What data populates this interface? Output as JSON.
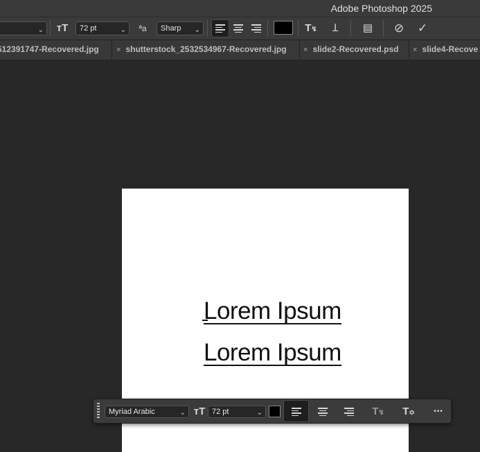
{
  "window": {
    "title": "Adobe Photoshop 2025"
  },
  "options_bar": {
    "font_size": "72 pt",
    "anti_alias": "Sharp",
    "icons": [
      "chevron-down-icon",
      "text-size-icon",
      "anti-alias-icon",
      "align-left-icon",
      "align-center-icon",
      "align-right-icon",
      "warp-text-icon",
      "3d-text-icon",
      "character-panel-icon",
      "cancel-icon",
      "commit-checkmark-icon"
    ],
    "text_color": "#000000"
  },
  "tabs": [
    {
      "label": "512391747-Recovered.jpg",
      "close": ""
    },
    {
      "label": "shutterstock_2532534967-Recovered.jpg",
      "close": "×"
    },
    {
      "label": "slide2-Recovered.psd",
      "close": "×"
    },
    {
      "label": "slide4-Recove",
      "close": "×"
    }
  ],
  "canvas": {
    "lines": [
      "Lorem Ipsum",
      "Lorem Ipsum"
    ]
  },
  "contextual_task_bar": {
    "font_family": "Myriad Arabic",
    "font_size": "72 pt",
    "text_color": "#000000",
    "more_label": "•••"
  },
  "colors": {
    "accent_bg": "#3a3a3a",
    "canvas_bg": "#282828",
    "doc_bg": "#ffffff"
  }
}
